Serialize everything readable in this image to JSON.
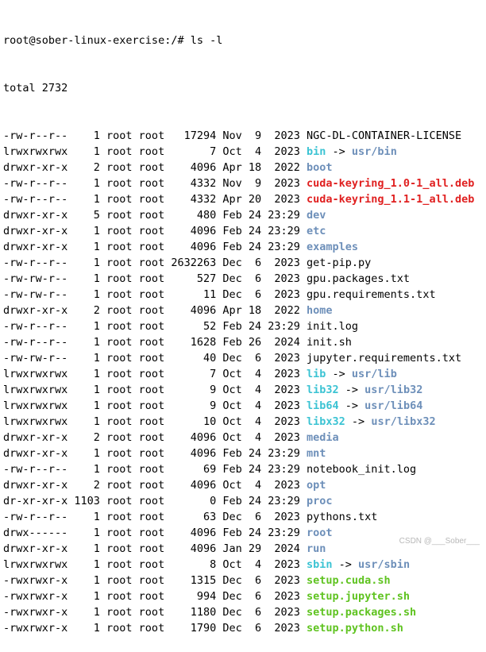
{
  "prompt": "root@sober-linux-exercise:/# ls -l",
  "total": "total 2732",
  "colors": {
    "directory": "#6d8fb9",
    "symlink": "#3bc3d3",
    "archive": "#e02020",
    "executable": "#5fc320",
    "regular": "#000000"
  },
  "entries": [
    {
      "perms": "-rw-r--r--",
      "links": "1",
      "owner": "root",
      "group": "root",
      "size": "17294",
      "month": "Nov",
      "day": "9",
      "time": "2023",
      "name": "NGC-DL-CONTAINER-LICENSE",
      "type": "file",
      "target": ""
    },
    {
      "perms": "lrwxrwxrwx",
      "links": "1",
      "owner": "root",
      "group": "root",
      "size": "7",
      "month": "Oct",
      "day": "4",
      "time": "2023",
      "name": "bin",
      "type": "link",
      "target": "usr/bin"
    },
    {
      "perms": "drwxr-xr-x",
      "links": "2",
      "owner": "root",
      "group": "root",
      "size": "4096",
      "month": "Apr",
      "day": "18",
      "time": "2022",
      "name": "boot",
      "type": "dir",
      "target": ""
    },
    {
      "perms": "-rw-r--r--",
      "links": "1",
      "owner": "root",
      "group": "root",
      "size": "4332",
      "month": "Nov",
      "day": "9",
      "time": "2023",
      "name": "cuda-keyring_1.0-1_all.deb",
      "type": "archive",
      "target": ""
    },
    {
      "perms": "-rw-r--r--",
      "links": "1",
      "owner": "root",
      "group": "root",
      "size": "4332",
      "month": "Apr",
      "day": "20",
      "time": "2023",
      "name": "cuda-keyring_1.1-1_all.deb",
      "type": "archive",
      "target": ""
    },
    {
      "perms": "drwxr-xr-x",
      "links": "5",
      "owner": "root",
      "group": "root",
      "size": "480",
      "month": "Feb",
      "day": "24",
      "time": "23:29",
      "name": "dev",
      "type": "dir",
      "target": ""
    },
    {
      "perms": "drwxr-xr-x",
      "links": "1",
      "owner": "root",
      "group": "root",
      "size": "4096",
      "month": "Feb",
      "day": "24",
      "time": "23:29",
      "name": "etc",
      "type": "dir",
      "target": ""
    },
    {
      "perms": "drwxr-xr-x",
      "links": "1",
      "owner": "root",
      "group": "root",
      "size": "4096",
      "month": "Feb",
      "day": "24",
      "time": "23:29",
      "name": "examples",
      "type": "dir",
      "target": ""
    },
    {
      "perms": "-rw-r--r--",
      "links": "1",
      "owner": "root",
      "group": "root",
      "size": "2632263",
      "month": "Dec",
      "day": "6",
      "time": "2023",
      "name": "get-pip.py",
      "type": "file",
      "target": ""
    },
    {
      "perms": "-rw-rw-r--",
      "links": "1",
      "owner": "root",
      "group": "root",
      "size": "527",
      "month": "Dec",
      "day": "6",
      "time": "2023",
      "name": "gpu.packages.txt",
      "type": "file",
      "target": ""
    },
    {
      "perms": "-rw-rw-r--",
      "links": "1",
      "owner": "root",
      "group": "root",
      "size": "11",
      "month": "Dec",
      "day": "6",
      "time": "2023",
      "name": "gpu.requirements.txt",
      "type": "file",
      "target": ""
    },
    {
      "perms": "drwxr-xr-x",
      "links": "2",
      "owner": "root",
      "group": "root",
      "size": "4096",
      "month": "Apr",
      "day": "18",
      "time": "2022",
      "name": "home",
      "type": "dir",
      "target": ""
    },
    {
      "perms": "-rw-r--r--",
      "links": "1",
      "owner": "root",
      "group": "root",
      "size": "52",
      "month": "Feb",
      "day": "24",
      "time": "23:29",
      "name": "init.log",
      "type": "file",
      "target": ""
    },
    {
      "perms": "-rw-r--r--",
      "links": "1",
      "owner": "root",
      "group": "root",
      "size": "1628",
      "month": "Feb",
      "day": "26",
      "time": "2024",
      "name": "init.sh",
      "type": "file",
      "target": ""
    },
    {
      "perms": "-rw-rw-r--",
      "links": "1",
      "owner": "root",
      "group": "root",
      "size": "40",
      "month": "Dec",
      "day": "6",
      "time": "2023",
      "name": "jupyter.requirements.txt",
      "type": "file",
      "target": ""
    },
    {
      "perms": "lrwxrwxrwx",
      "links": "1",
      "owner": "root",
      "group": "root",
      "size": "7",
      "month": "Oct",
      "day": "4",
      "time": "2023",
      "name": "lib",
      "type": "link",
      "target": "usr/lib"
    },
    {
      "perms": "lrwxrwxrwx",
      "links": "1",
      "owner": "root",
      "group": "root",
      "size": "9",
      "month": "Oct",
      "day": "4",
      "time": "2023",
      "name": "lib32",
      "type": "link",
      "target": "usr/lib32"
    },
    {
      "perms": "lrwxrwxrwx",
      "links": "1",
      "owner": "root",
      "group": "root",
      "size": "9",
      "month": "Oct",
      "day": "4",
      "time": "2023",
      "name": "lib64",
      "type": "link",
      "target": "usr/lib64"
    },
    {
      "perms": "lrwxrwxrwx",
      "links": "1",
      "owner": "root",
      "group": "root",
      "size": "10",
      "month": "Oct",
      "day": "4",
      "time": "2023",
      "name": "libx32",
      "type": "link",
      "target": "usr/libx32"
    },
    {
      "perms": "drwxr-xr-x",
      "links": "2",
      "owner": "root",
      "group": "root",
      "size": "4096",
      "month": "Oct",
      "day": "4",
      "time": "2023",
      "name": "media",
      "type": "dir",
      "target": ""
    },
    {
      "perms": "drwxr-xr-x",
      "links": "1",
      "owner": "root",
      "group": "root",
      "size": "4096",
      "month": "Feb",
      "day": "24",
      "time": "23:29",
      "name": "mnt",
      "type": "dir",
      "target": ""
    },
    {
      "perms": "-rw-r--r--",
      "links": "1",
      "owner": "root",
      "group": "root",
      "size": "69",
      "month": "Feb",
      "day": "24",
      "time": "23:29",
      "name": "notebook_init.log",
      "type": "file",
      "target": ""
    },
    {
      "perms": "drwxr-xr-x",
      "links": "2",
      "owner": "root",
      "group": "root",
      "size": "4096",
      "month": "Oct",
      "day": "4",
      "time": "2023",
      "name": "opt",
      "type": "dir",
      "target": ""
    },
    {
      "perms": "dr-xr-xr-x",
      "links": "1103",
      "owner": "root",
      "group": "root",
      "size": "0",
      "month": "Feb",
      "day": "24",
      "time": "23:29",
      "name": "proc",
      "type": "dir",
      "target": ""
    },
    {
      "perms": "-rw-r--r--",
      "links": "1",
      "owner": "root",
      "group": "root",
      "size": "63",
      "month": "Dec",
      "day": "6",
      "time": "2023",
      "name": "pythons.txt",
      "type": "file",
      "target": ""
    },
    {
      "perms": "drwx------",
      "links": "1",
      "owner": "root",
      "group": "root",
      "size": "4096",
      "month": "Feb",
      "day": "24",
      "time": "23:29",
      "name": "root",
      "type": "dir",
      "target": ""
    },
    {
      "perms": "drwxr-xr-x",
      "links": "1",
      "owner": "root",
      "group": "root",
      "size": "4096",
      "month": "Jan",
      "day": "29",
      "time": "2024",
      "name": "run",
      "type": "dir",
      "target": ""
    },
    {
      "perms": "lrwxrwxrwx",
      "links": "1",
      "owner": "root",
      "group": "root",
      "size": "8",
      "month": "Oct",
      "day": "4",
      "time": "2023",
      "name": "sbin",
      "type": "link",
      "target": "usr/sbin"
    },
    {
      "perms": "-rwxrwxr-x",
      "links": "1",
      "owner": "root",
      "group": "root",
      "size": "1315",
      "month": "Dec",
      "day": "6",
      "time": "2023",
      "name": "setup.cuda.sh",
      "type": "exec",
      "target": ""
    },
    {
      "perms": "-rwxrwxr-x",
      "links": "1",
      "owner": "root",
      "group": "root",
      "size": "994",
      "month": "Dec",
      "day": "6",
      "time": "2023",
      "name": "setup.jupyter.sh",
      "type": "exec",
      "target": ""
    },
    {
      "perms": "-rwxrwxr-x",
      "links": "1",
      "owner": "root",
      "group": "root",
      "size": "1180",
      "month": "Dec",
      "day": "6",
      "time": "2023",
      "name": "setup.packages.sh",
      "type": "exec",
      "target": ""
    },
    {
      "perms": "-rwxrwxr-x",
      "links": "1",
      "owner": "root",
      "group": "root",
      "size": "1790",
      "month": "Dec",
      "day": "6",
      "time": "2023",
      "name": "setup.python.sh",
      "type": "exec",
      "target": ""
    }
  ],
  "watermark": "CSDN @___Sober___"
}
